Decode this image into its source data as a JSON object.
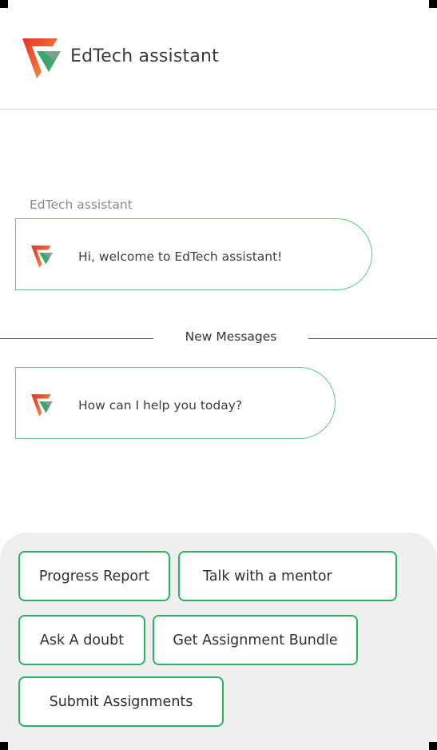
{
  "header": {
    "title": "EdTech assistant",
    "logo_icon": "edtech-logo-icon"
  },
  "chat": {
    "sender_name": "EdTech assistant",
    "messages": [
      {
        "text": "Hi, welcome to EdTech assistant!"
      },
      {
        "text": "How can I help you today?"
      }
    ],
    "divider_label": "New Messages"
  },
  "quick_replies": [
    {
      "label": "Progress Report"
    },
    {
      "label": "Talk with a mentor"
    },
    {
      "label": "Ask A doubt"
    },
    {
      "label": "Get Assignment Bundle"
    },
    {
      "label": "Submit Assignments"
    }
  ],
  "colors": {
    "accent_green": "#28b45c",
    "bubble_border": "#5fca83",
    "logo_orange": "#f26b2a",
    "logo_red": "#d93a2f",
    "logo_green": "#3aa76d",
    "panel_bg": "#efefef"
  }
}
